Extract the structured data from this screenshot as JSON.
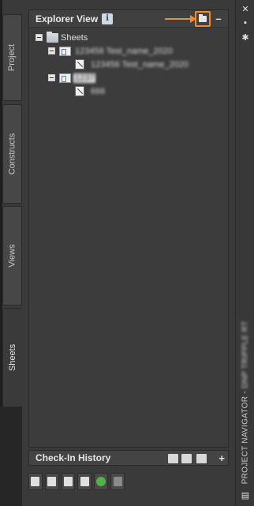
{
  "palette": {
    "title_prefix": "PROJECT NAVIGATOR - ",
    "title_project": "DNP TRIPPLE RT"
  },
  "side_tabs": [
    {
      "label": "Project"
    },
    {
      "label": "Constructs"
    },
    {
      "label": "Views"
    },
    {
      "label": "Sheets"
    }
  ],
  "explorer": {
    "title": "Explorer View",
    "info_icon": "i",
    "minimize_symbol": "–",
    "tree": {
      "root": "Sheets",
      "set1": "123456 Test_name_2020",
      "set1_child": "123456 Test_name_2020",
      "set2": "1237",
      "set2_child": "666"
    }
  },
  "checkin": {
    "title": "Check-In History",
    "plus_symbol": "+"
  },
  "right_strip": {
    "close_symbol": "✕"
  }
}
